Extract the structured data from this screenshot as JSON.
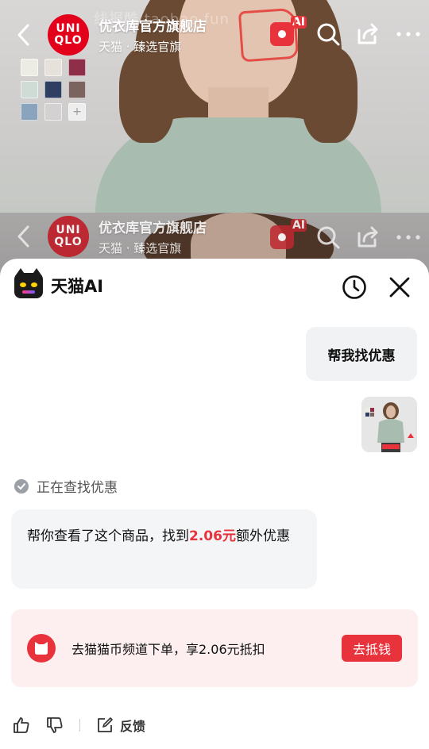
{
  "header": {
    "store_name": "优衣库官方旗舰店",
    "store_sub": "天猫 · 臻选官旗",
    "logo_line1": "UNI",
    "logo_line2": "QLO",
    "ai_tag": "AI",
    "watermark": "线报酷 taobao.fun"
  },
  "swatches": [
    "#ecebe4",
    "#e6e1da",
    "#8e2e49",
    "#cfdcd6",
    "#2e3f62",
    "#7b6460",
    "#8aa4bd",
    "#d4d1d2"
  ],
  "swatch_more": "+",
  "sheet": {
    "title": "天猫AI",
    "user_message": "帮我找优惠",
    "status_text": "正在查找优惠",
    "answer_before": "帮你查看了这个商品，找到",
    "answer_highlight": "2.06元",
    "answer_after": "额外优惠",
    "offer_text": "去猫猫币频道下单，享2.06元抵扣",
    "offer_button": "去抵钱",
    "feedback_label": "反馈"
  },
  "colors": {
    "brand_red": "#e8323c",
    "uniqlo_red": "#e3001b",
    "offer_bg": "#fdeff0"
  }
}
